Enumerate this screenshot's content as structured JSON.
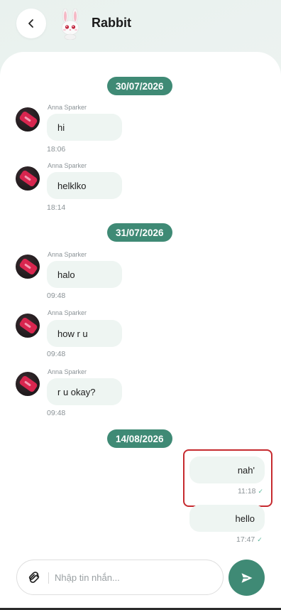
{
  "header": {
    "title": "Rabbit"
  },
  "groups": [
    {
      "date": "30/07/2026"
    },
    {
      "date": "31/07/2026"
    },
    {
      "date": "14/08/2026"
    }
  ],
  "incoming": [
    {
      "sender": "Anna Sparker",
      "text": "hi",
      "time": "18:06"
    },
    {
      "sender": "Anna Sparker",
      "text": "helklko",
      "time": "18:14"
    },
    {
      "sender": "Anna Sparker",
      "text": "halo",
      "time": "09:48"
    },
    {
      "sender": "Anna Sparker",
      "text": "how r u",
      "time": "09:48"
    },
    {
      "sender": "Anna Sparker",
      "text": "r u okay?",
      "time": "09:48"
    }
  ],
  "outgoing": [
    {
      "text": "nah'",
      "time": "11:18"
    },
    {
      "text": "hello",
      "time": "17:47"
    }
  ],
  "composer": {
    "placeholder": "Nhập tin nhắn..."
  },
  "colors": {
    "accent": "#3f8a75",
    "bubble": "#eef5f2",
    "highlight": "#c62a2f"
  }
}
